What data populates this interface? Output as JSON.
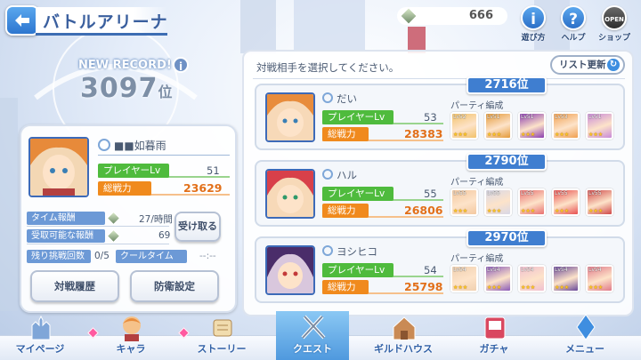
{
  "header": {
    "title": "バトルアリーナ",
    "coins": "666"
  },
  "top_buttons": [
    {
      "label": "遊び方",
      "icon": "info-icon"
    },
    {
      "label": "ヘルプ",
      "icon": "help-icon"
    },
    {
      "label": "ショップ",
      "icon": "shop-icon",
      "tag": "OPEN"
    }
  ],
  "record": {
    "new_record": "NEW RECORD!",
    "rank": "3097",
    "rank_suffix": "位"
  },
  "player": {
    "name": "■■如暮雨",
    "level_label": "プレイヤーLv",
    "level": "51",
    "power_label": "総戦力",
    "power": "23629"
  },
  "rewards": {
    "time_label": "タイム報酬",
    "time_value": "27/時間",
    "receivable_label": "受取可能な報酬",
    "receivable_value": "69",
    "remaining_label": "残り挑戦回数",
    "remaining_value": "0/5",
    "cooltime_label": "クールタイム",
    "cooltime_value": "--:--",
    "receive_button": "受け取る"
  },
  "left_buttons": {
    "history": "対戦履歴",
    "defense": "防衛設定"
  },
  "opponents_header": "対戦相手を選択してください。",
  "refresh_label": "リスト更新",
  "party_label": "パーティ編成",
  "opponents": [
    {
      "rank": "2716位",
      "name": "だい",
      "level_label": "プレイヤーLv",
      "level": "53",
      "power_label": "総戦力",
      "power": "28383",
      "party": [
        {
          "lv": "Lv52"
        },
        {
          "lv": "Lv51"
        },
        {
          "lv": "Lv51"
        },
        {
          "lv": "Lv53"
        },
        {
          "lv": "Lv51"
        }
      ]
    },
    {
      "rank": "2790位",
      "name": "ハル",
      "level_label": "プレイヤーLv",
      "level": "55",
      "power_label": "総戦力",
      "power": "26806",
      "party": [
        {
          "lv": "Lv55"
        },
        {
          "lv": "Lv55"
        },
        {
          "lv": "Lv55"
        },
        {
          "lv": "Lv55"
        },
        {
          "lv": "Lv55"
        }
      ]
    },
    {
      "rank": "2970位",
      "name": "ヨシヒコ",
      "level_label": "プレイヤーLv",
      "level": "54",
      "power_label": "総戦力",
      "power": "25798",
      "party": [
        {
          "lv": "Lv54"
        },
        {
          "lv": "Lv54"
        },
        {
          "lv": "Lv54"
        },
        {
          "lv": "Lv54"
        },
        {
          "lv": "Lv54"
        }
      ]
    }
  ],
  "nav": [
    {
      "label": "マイページ",
      "icon": "castle-icon"
    },
    {
      "label": "キャラ",
      "icon": "character-icon",
      "badge": true
    },
    {
      "label": "ストーリー",
      "icon": "scroll-icon",
      "badge": true
    },
    {
      "label": "クエスト",
      "icon": "swords-icon",
      "active": true
    },
    {
      "label": "ギルドハウス",
      "icon": "guild-house-icon"
    },
    {
      "label": "ガチャ",
      "icon": "gacha-icon"
    },
    {
      "label": "メニュー",
      "icon": "crystal-icon"
    }
  ],
  "colors": {
    "accent": "#3f7ed0",
    "level": "#4fbb3d",
    "power": "#f08a1d",
    "active_tab": "#5aa7ee"
  }
}
